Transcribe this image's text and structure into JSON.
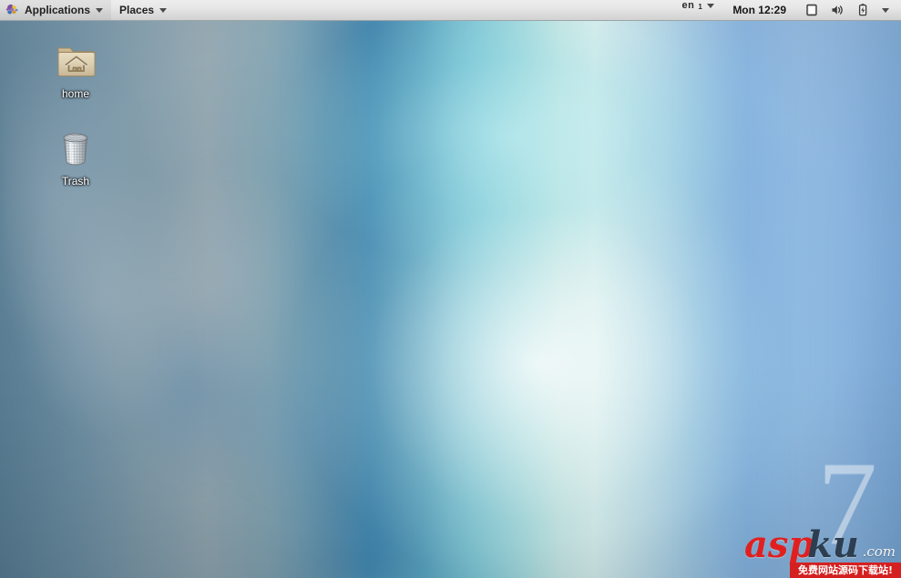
{
  "panel": {
    "applications_label": "Applications",
    "places_label": "Places",
    "foot_icon": "gnome-foot-icon",
    "applications_caret_icon": "chevron-down-icon",
    "places_caret_icon": "chevron-down-icon",
    "keyboard_layout": "en",
    "keyboard_layout_sub": "1",
    "keyboard_caret_icon": "chevron-down-icon",
    "clock": "Mon 12:29",
    "display_icon": "display-icon",
    "volume_icon": "speaker-volume-icon",
    "battery_icon": "battery-charging-icon",
    "user_menu_caret_icon": "chevron-down-icon"
  },
  "desktop": {
    "icons": [
      {
        "name": "home",
        "label": "home",
        "icon": "home-folder-icon"
      },
      {
        "name": "trash",
        "label": "Trash",
        "icon": "trash-can-icon"
      }
    ],
    "wallpaper_number": "7"
  },
  "watermark": {
    "asp": "asp",
    "ku": "ku",
    "com": ".com",
    "banner": "免费网站源码下载站!",
    "brand_red": "#e02020",
    "brand_dark": "#2c3e50"
  }
}
